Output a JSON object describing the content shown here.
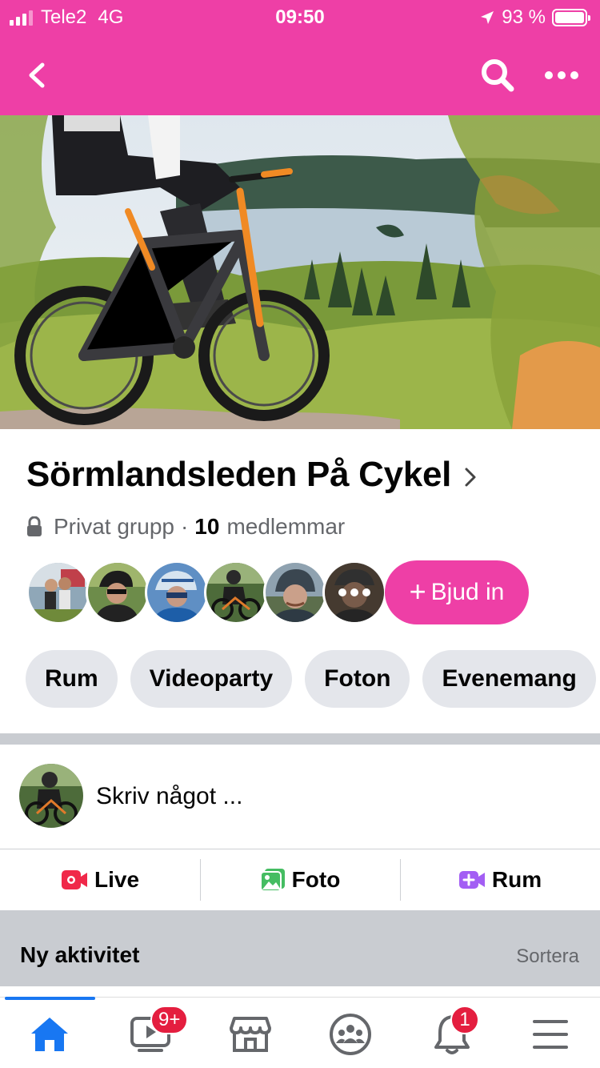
{
  "status_bar": {
    "carrier": "Tele2",
    "network": "4G",
    "time": "09:50",
    "battery": "93 %"
  },
  "nav": {
    "back_icon": "chevron-left-icon",
    "search_icon": "search-icon",
    "more_icon": "more-horizontal-icon"
  },
  "group": {
    "name": "Sörmlandsleden På Cykel",
    "privacy": "Privat grupp",
    "separator": "·",
    "member_count": "10",
    "member_label": "medlemmar",
    "invite_label": "Bjud in",
    "invite_plus": "+"
  },
  "chips": [
    "Rum",
    "Videoparty",
    "Foton",
    "Evenemang"
  ],
  "composer": {
    "placeholder": "Skriv något ..."
  },
  "post_actions": {
    "live": "Live",
    "photo": "Foto",
    "room": "Rum"
  },
  "activity": {
    "title": "Ny aktivitet",
    "sort": "Sortera"
  },
  "tabbar": {
    "video_badge": "9+",
    "notifications_badge": "1"
  },
  "colors": {
    "brand": "#ee3fa6",
    "active_tab": "#1877f2",
    "badge": "#e41e3f"
  }
}
